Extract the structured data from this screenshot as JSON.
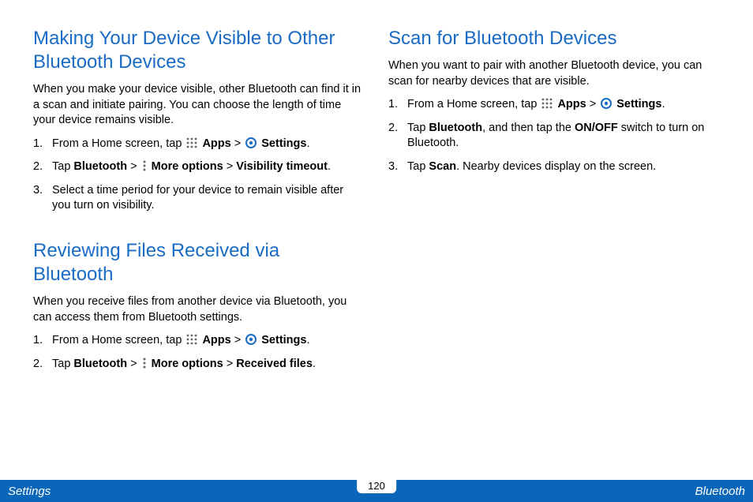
{
  "col1": {
    "h1": "Making Your Device Visible to Other Bluetooth Devices",
    "p1": "When you make your device visible, other Bluetooth can find it in a scan and initiate pairing. You can choose the length of time your device remains visible.",
    "s1a": "From a Home screen, tap ",
    "s1b": "Apps",
    "s1c": " > ",
    "s1d": "Settings",
    "s1e": ".",
    "s2a": "Tap ",
    "s2b": "Bluetooth",
    "s2c": " > ",
    "s2d": "More options",
    "s2e": " > ",
    "s2f": "Visibility timeout",
    "s2g": ".",
    "s3": "Select a time period for your device to remain visible after you turn on visibility.",
    "h2": "Reviewing Files Received via Bluetooth",
    "p2": "When you receive files from another device via Bluetooth, you can access them from Bluetooth settings.",
    "r1a": "From a Home screen, tap ",
    "r1b": "Apps",
    "r1c": " > ",
    "r1d": "Settings",
    "r1e": ".",
    "r2a": "Tap ",
    "r2b": "Bluetooth",
    "r2c": " > ",
    "r2d": "More options",
    "r2e": " > ",
    "r2f": "Received files",
    "r2g": "."
  },
  "col2": {
    "h1": "Scan for Bluetooth Devices",
    "p1": "When you want to pair with another Bluetooth device, you can scan for nearby devices that are visible.",
    "s1a": "From a Home screen, tap ",
    "s1b": "Apps",
    "s1c": " > ",
    "s1d": "Settings",
    "s1e": ".",
    "s2a": "Tap ",
    "s2b": "Bluetooth",
    "s2c": ", and then tap the ",
    "s2d": "ON/OFF",
    "s2e": " switch to turn on Bluetooth.",
    "s3a": "Tap ",
    "s3b": "Scan",
    "s3c": ". Nearby devices display on the screen."
  },
  "footer": {
    "left": "Settings",
    "page": "120",
    "right": "Bluetooth"
  }
}
